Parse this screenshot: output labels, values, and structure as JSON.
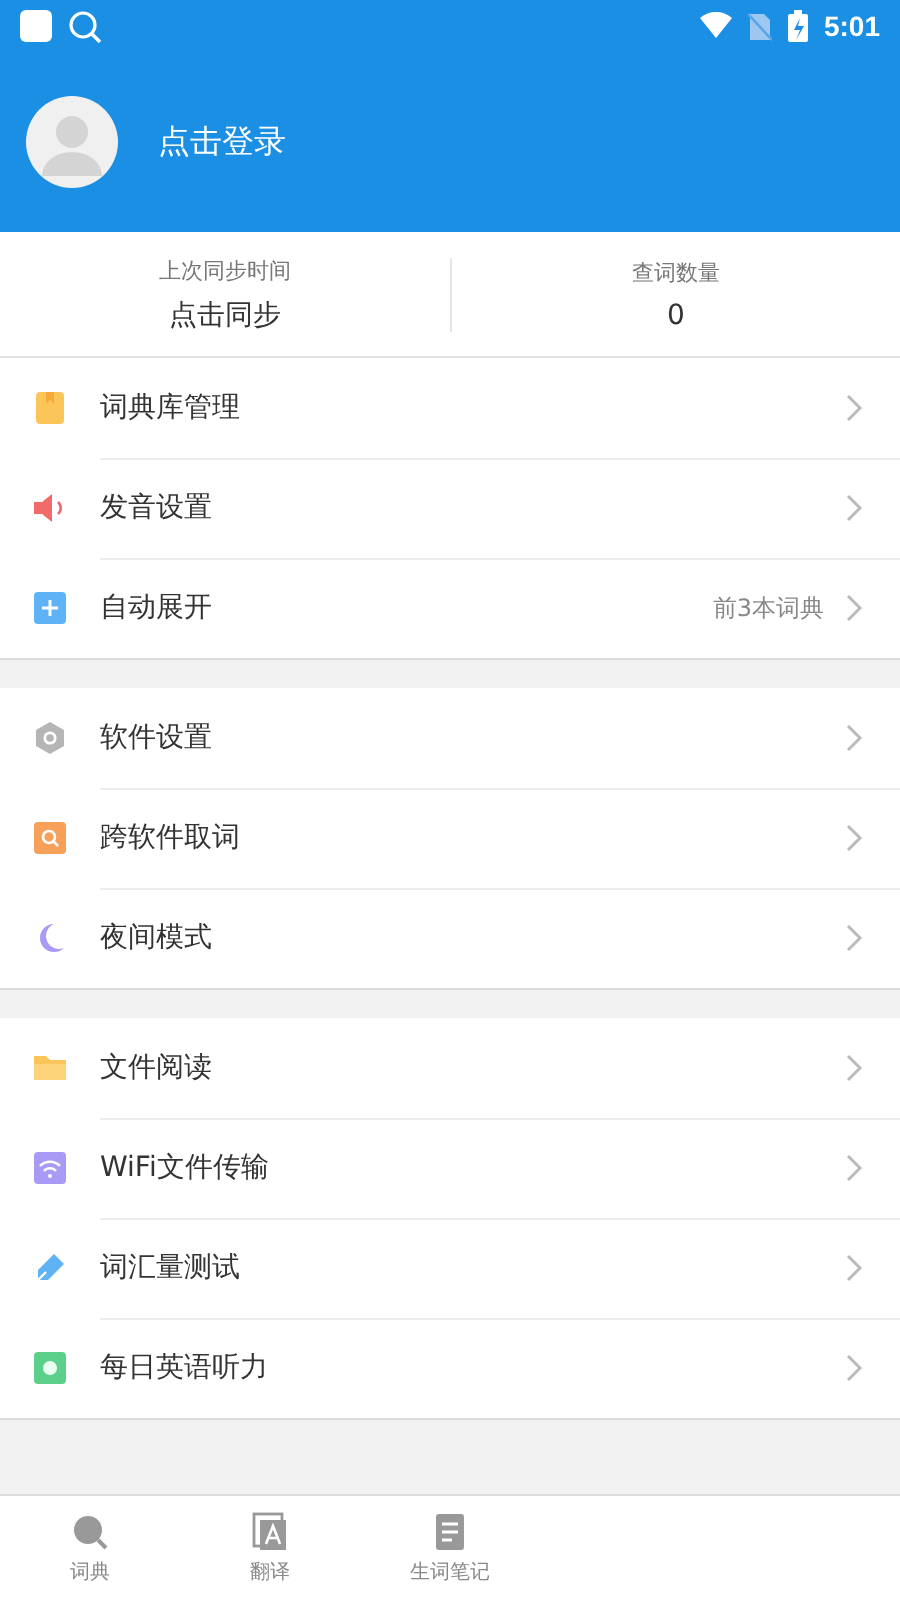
{
  "status_bar": {
    "time": "5:01"
  },
  "header": {
    "login": "点击登录"
  },
  "stats": [
    {
      "label": "上次同步时间",
      "value": "点击同步"
    },
    {
      "label": "查词数量",
      "value": "0"
    }
  ],
  "groups": [
    {
      "items": [
        {
          "label": "词典库管理"
        },
        {
          "label": "发音设置"
        },
        {
          "label": "自动展开",
          "detail": "前3本词典"
        }
      ]
    },
    {
      "items": [
        {
          "label": "软件设置"
        },
        {
          "label": "跨软件取词"
        },
        {
          "label": "夜间模式"
        }
      ]
    },
    {
      "items": [
        {
          "label": "文件阅读"
        },
        {
          "label": "WiFi文件传输"
        },
        {
          "label": "词汇量测试"
        },
        {
          "label": "每日英语听力"
        }
      ]
    }
  ],
  "tab_bar": [
    {
      "label": "词典"
    },
    {
      "label": "翻译"
    },
    {
      "label": "生词笔记"
    }
  ]
}
